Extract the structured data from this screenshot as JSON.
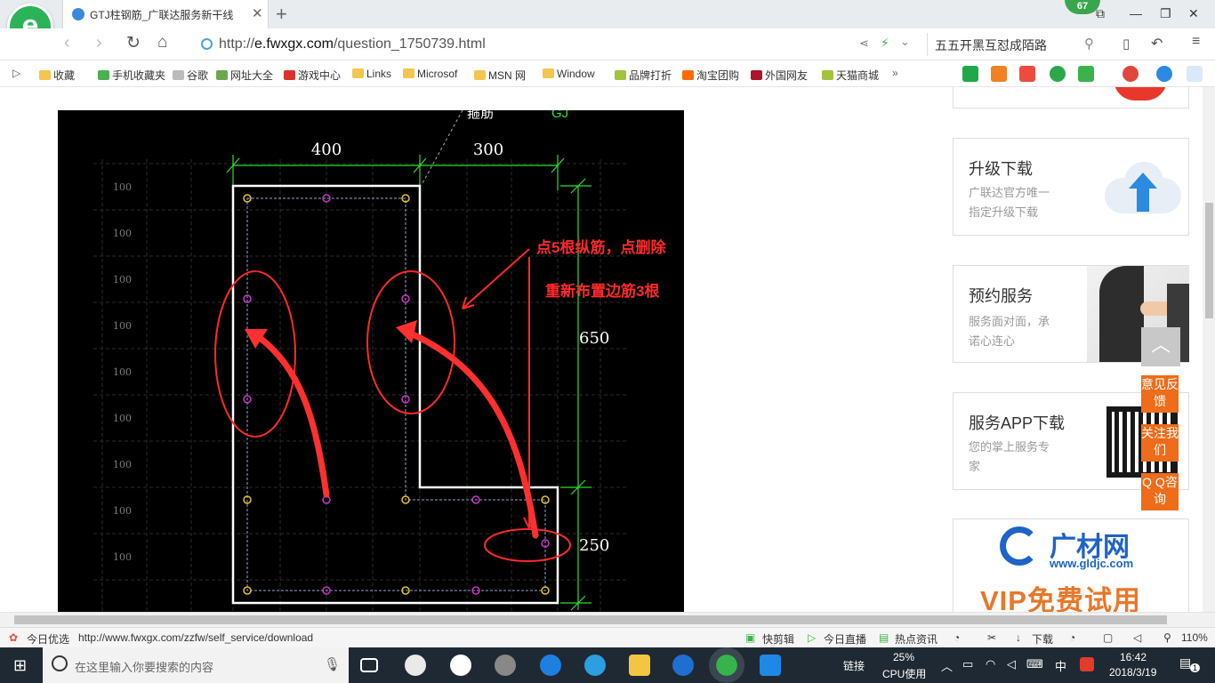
{
  "browser": {
    "tab_title": "GTJ柱钢筋_广联达服务新干线",
    "badge": "67",
    "url_prefix": "http://",
    "url_domain": "e.fwxgx.com",
    "url_path": "/question_1750739.html",
    "search_text": "五五开黑互怼成陌路"
  },
  "bookmarks": [
    "收藏",
    "手机收藏夹",
    "谷歌",
    "网址大全",
    "游戏中心",
    "Links",
    "Microsof",
    "MSN 网",
    "Window",
    "品牌打折",
    "淘宝团购",
    "外国网友",
    "天猫商城"
  ],
  "drawing": {
    "dims": {
      "top_left": "400",
      "top_right": "300",
      "right_upper": "650",
      "right_lower": "250"
    },
    "label_stirrup": "箍筋",
    "label_gj": "GJ",
    "row_labels": [
      "100",
      "100",
      "100",
      "100",
      "100",
      "100",
      "100",
      "100",
      "100"
    ],
    "annotation1": "点5根纵筋，点删除",
    "annotation2": "重新布置边筋3根",
    "colors": {
      "outline": "#ffffff",
      "annotation": "#ff2a2a",
      "dimension": "#2ee02e",
      "corner_bar": "#e6c229",
      "edge_bar": "#cc33cc"
    }
  },
  "sidebar": {
    "card1": {
      "title": "升级下载",
      "desc": [
        "广联达官方唯一",
        "指定升级下载"
      ]
    },
    "card2": {
      "title": "预约服务",
      "desc": [
        "服务面对面，承",
        "诺心连心"
      ]
    },
    "card3": {
      "title": "服务APP下载",
      "desc": [
        "您的掌上服务专",
        "家"
      ]
    },
    "ad": {
      "brand": "广材网",
      "domain": "www.gldjc.com",
      "slogan": "VIP免费试用"
    }
  },
  "float_buttons": [
    "意见反馈",
    "关注我们",
    "Q Q咨询"
  ],
  "statusbar": {
    "left_label": "今日优选",
    "link": "http://www.fwxgx.com/zzfw/self_service/download",
    "items": [
      "快剪辑",
      "今日直播",
      "热点资讯",
      "下载"
    ],
    "zoom": "110%"
  },
  "taskbar": {
    "search_placeholder": "在这里输入你要搜索的内容",
    "link_label": "链接",
    "cpu_percent": "25%",
    "cpu_label": "CPU使用",
    "ime": "中",
    "time": "16:42",
    "date": "2018/3/19",
    "notifications": "1"
  }
}
